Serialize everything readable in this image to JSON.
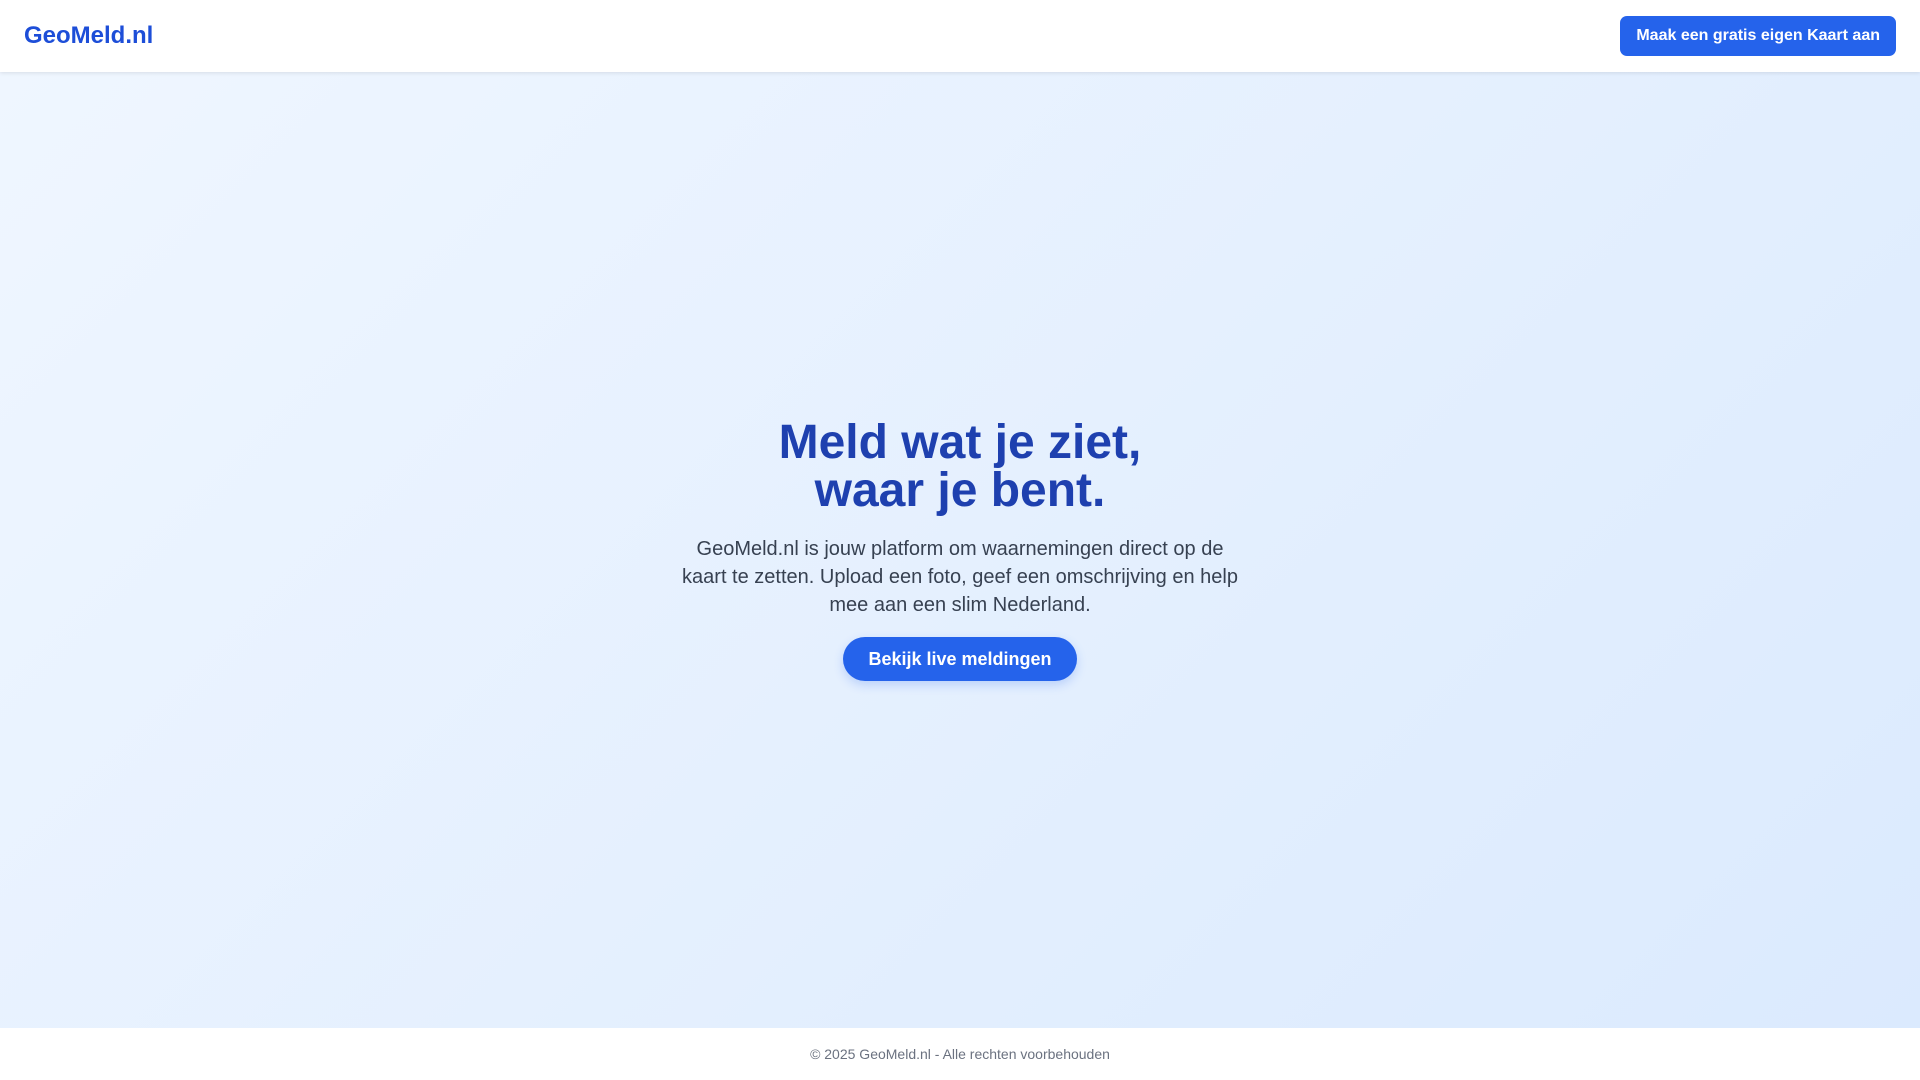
{
  "header": {
    "logo": "GeoMeld.nl",
    "cta_label": "Maak een gratis eigen Kaart aan"
  },
  "hero": {
    "title_line1": "Meld wat je ziet,",
    "title_line2": "waar je bent.",
    "description": "GeoMeld.nl is jouw platform om waarnemingen direct op de kaart te zetten. Upload een foto, geef een omschrijving en help mee aan een slim Nederland.",
    "cta_label": "Bekijk live meldingen"
  },
  "footer": {
    "copyright": "© 2025 GeoMeld.nl - Alle rechten voorbehouden"
  },
  "colors": {
    "brand": "#2563eb",
    "title": "#1e40af",
    "logo": "#1d4ed8"
  }
}
